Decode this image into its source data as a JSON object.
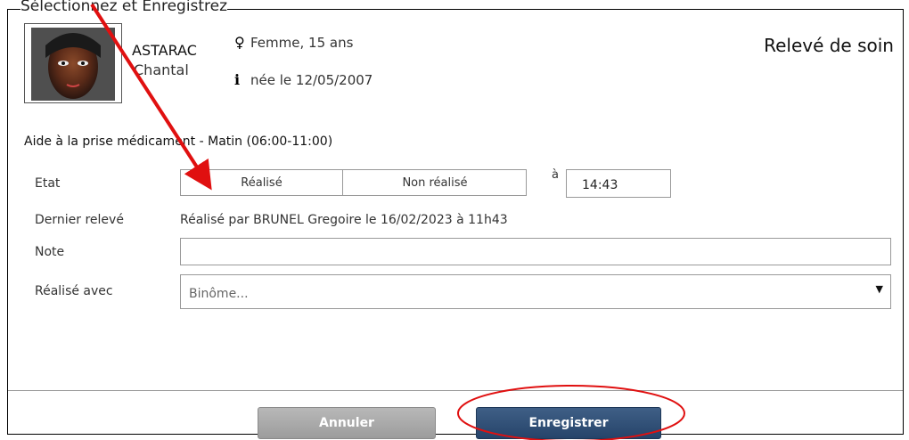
{
  "caption": "Sélectionnez et Enregistrez",
  "header": {
    "title": "Relevé de soin",
    "patient": {
      "last_name": "ASTARAC",
      "first_name": "Chantal",
      "sex_age": "Femme, 15 ans",
      "birth": "née le 12/05/2007"
    },
    "icons": {
      "sex": "female-person-icon",
      "info": "info-icon"
    }
  },
  "section": {
    "title": "Aide à la prise médicament - Matin (06:00-11:00)"
  },
  "form": {
    "etat": {
      "label": "Etat",
      "options": [
        "Réalisé",
        "Non réalisé"
      ],
      "at_label": "à",
      "time": "14:43"
    },
    "last_record": {
      "label": "Dernier relevé",
      "value": "Réalisé par BRUNEL Gregoire le 16/02/2023 à 11h43"
    },
    "note": {
      "label": "Note",
      "value": ""
    },
    "done_with": {
      "label": "Réalisé avec",
      "placeholder": "Binôme..."
    }
  },
  "buttons": {
    "cancel": "Annuler",
    "save": "Enregistrer"
  },
  "colors": {
    "annotation": "#e01010",
    "save_button": "#2f4e75",
    "cancel_button": "#a8a8a8"
  }
}
